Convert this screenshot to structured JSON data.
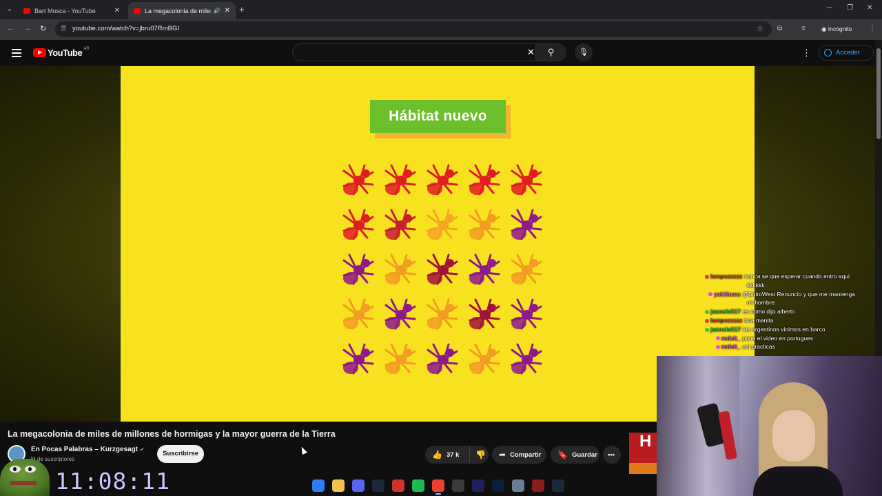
{
  "browser": {
    "tabs": [
      {
        "title": "Bart Mosca - YouTube"
      },
      {
        "title": "La megacolonia de miles de"
      }
    ],
    "url": "youtube.com/watch?v=jbru07RmBGI",
    "incognito_label": "Incógnito"
  },
  "youtube": {
    "logo_text": "YouTube",
    "country_code": "AR",
    "sign_in_label": "Acceder"
  },
  "video": {
    "badge_text": "Hábitat nuevo",
    "ant_rows": [
      [
        "#e11d24",
        "#e11d24",
        "#e11d24",
        "#e11d24",
        "#e11d24"
      ],
      [
        "#e11d24",
        "#c81f2e",
        "#f5a623",
        "#f39c23",
        "#8e1a8a"
      ],
      [
        "#8e1a8a",
        "#f39c23",
        "#a2133a",
        "#8e1a8a",
        "#f39c23"
      ],
      [
        "#f39c23",
        "#8e1a8a",
        "#f39c23",
        "#a2133a",
        "#8e1a8a"
      ],
      [
        "#8e1a8a",
        "#f39c23",
        "#8e1a8a",
        "#f39c23",
        "#8e1a8a"
      ]
    ],
    "title": "La megacolonia de miles de millones de hormigas y la mayor guerra de la Tierra",
    "channel": "En Pocas Palabras – Kurzgesagt",
    "subscribers": "M de suscriptores",
    "subscribe_label": "Suscribirse",
    "likes": "37 k",
    "share_label": "Compartir",
    "save_label": "Guardar"
  },
  "chat": [
    {
      "user": "lampozzzzz",
      "color": "#e23b3b",
      "text": "nunca se que esperar cuando entro aqui"
    },
    {
      "user": "",
      "color": "",
      "text": "kkkkkk"
    },
    {
      "user": "yakiiiuwu",
      "color": "#e04ee0",
      "text": "@ShiroWest Renuncio y que me mantenga"
    },
    {
      "user": "",
      "color": "",
      "text": "mi hombre"
    },
    {
      "user": "juanelo817",
      "color": "#3fbf3f",
      "text": "es como dijo alberto"
    },
    {
      "user": "lampozzzzz",
      "color": "#e23b3b",
      "text": "boa manita"
    },
    {
      "user": "juanelo817",
      "color": "#3fbf3f",
      "text": "los argentinos vinimos en barco"
    },
    {
      "user": "redsit_",
      "color": "#e04ee0",
      "text": "pone el video en portugues"
    },
    {
      "user": "redsit_",
      "color": "#e04ee0",
      "text": "asi practicas"
    }
  ],
  "overlay": {
    "clock": "11:08:11",
    "thumbnail_text": "H"
  },
  "taskbar": [
    {
      "name": "windows-start",
      "color": "#2f7cf6"
    },
    {
      "name": "file-explorer",
      "color": "#f2c14e"
    },
    {
      "name": "discord",
      "color": "#5865f2"
    },
    {
      "name": "steam",
      "color": "#1b2838"
    },
    {
      "name": "app-red",
      "color": "#d0312d"
    },
    {
      "name": "spotify",
      "color": "#1db954"
    },
    {
      "name": "chrome",
      "color": "#e94235"
    },
    {
      "name": "obs",
      "color": "#3a3a3a"
    },
    {
      "name": "premiere",
      "color": "#1f1f5e"
    },
    {
      "name": "photoshop",
      "color": "#0b1e3a"
    },
    {
      "name": "ccleaner",
      "color": "#6b7c93"
    },
    {
      "name": "game-app",
      "color": "#8b1c1c"
    },
    {
      "name": "steam-2",
      "color": "#1b2838"
    }
  ]
}
